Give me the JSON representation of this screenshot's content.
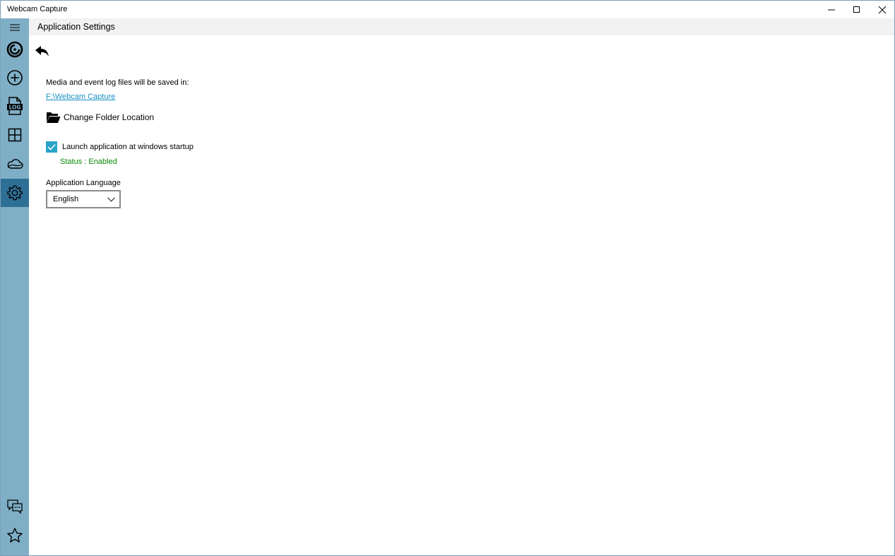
{
  "window": {
    "title": "Webcam Capture"
  },
  "header": {
    "title": "Application Settings"
  },
  "sidebar": {
    "items": [
      {
        "icon": "hamburger-menu-icon"
      },
      {
        "icon": "capture-icon"
      },
      {
        "icon": "add-circle-icon"
      },
      {
        "icon": "log-file-icon",
        "badge": "LOG"
      },
      {
        "icon": "grid-icon"
      },
      {
        "icon": "cloud-icon"
      },
      {
        "icon": "gear-icon",
        "active": true
      },
      {
        "icon": "chat-icon"
      },
      {
        "icon": "star-icon"
      }
    ]
  },
  "settings": {
    "saved_label": "Media and event log files will be saved in:",
    "folder_path": "F:\\Webcam Capture",
    "change_folder_label": "Change Folder Location",
    "startup_label": "Launch application at windows startup",
    "startup_checked": true,
    "status_text": "Status : Enabled",
    "language_label": "Application Language",
    "language_value": "English"
  },
  "colors": {
    "sidebar_bg": "#7fafc6",
    "sidebar_active": "#2e6f95",
    "checkbox": "#2aa3c8",
    "link": "#1a8fc4",
    "status_ok": "#0a8a0a"
  }
}
